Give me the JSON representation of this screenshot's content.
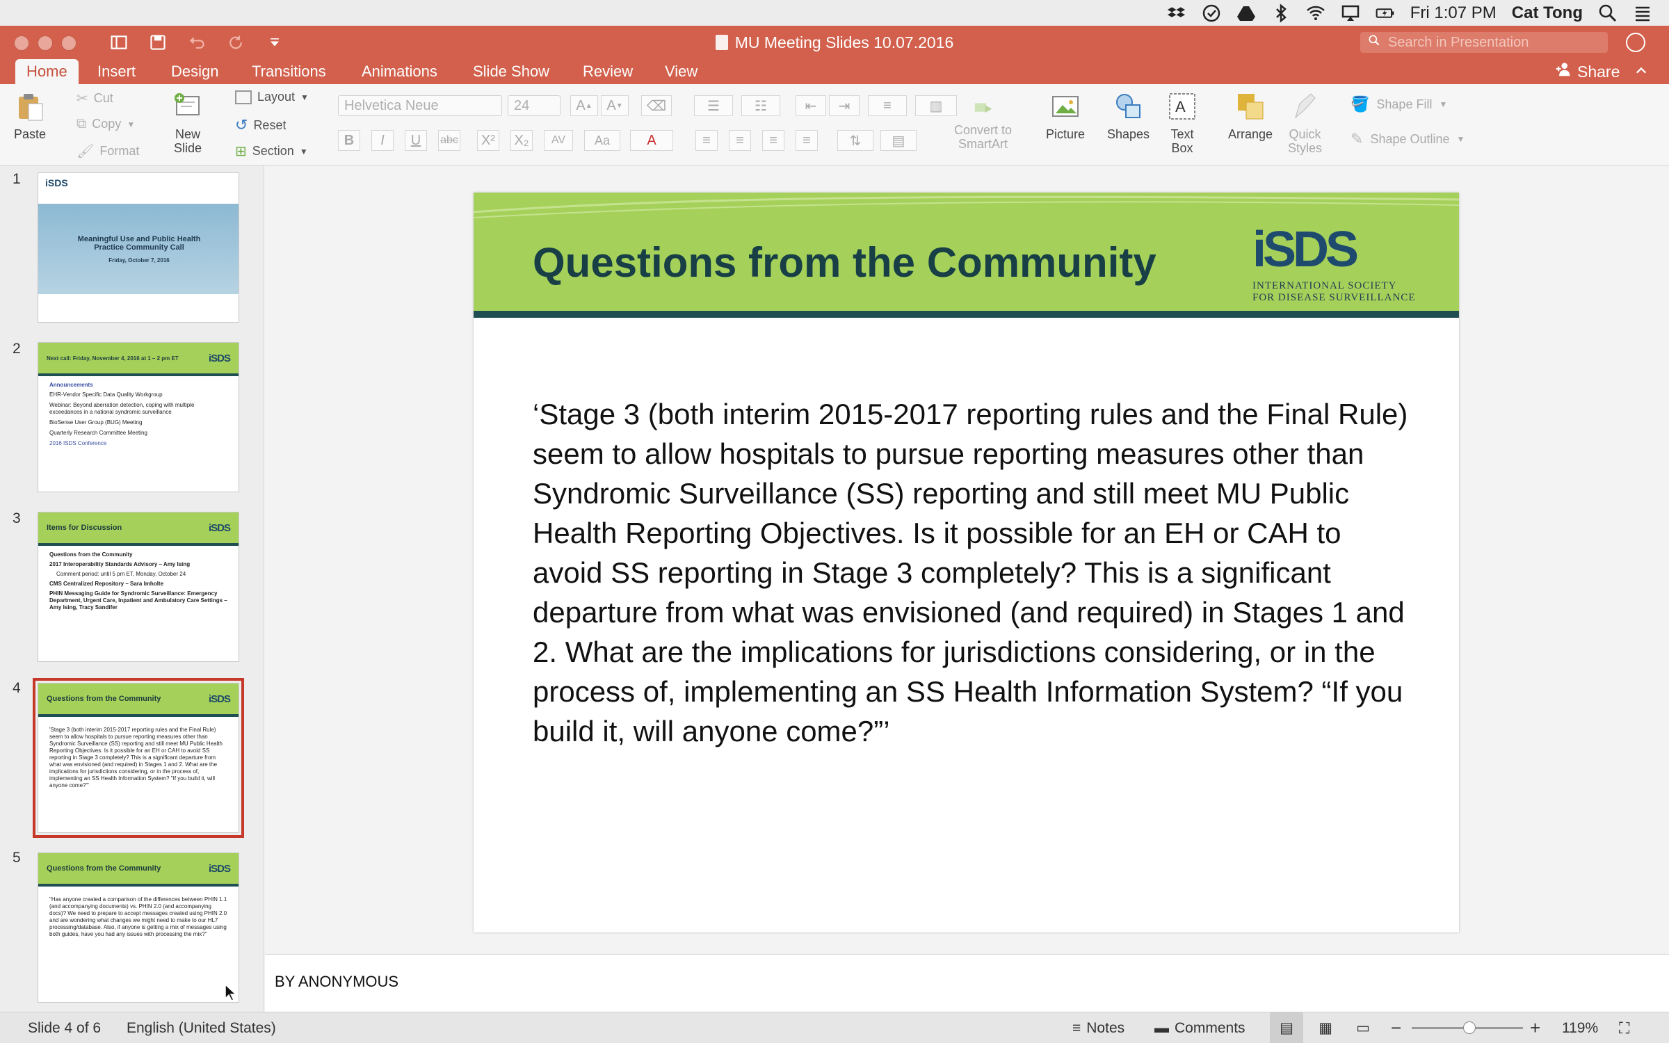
{
  "menubar": {
    "clock": "Fri 1:07 PM",
    "user": "Cat Tong"
  },
  "titlebar": {
    "document_title": "MU Meeting Slides 10.07.2016",
    "search_placeholder": "Search in Presentation"
  },
  "tabs": [
    {
      "label": "Home",
      "active": true
    },
    {
      "label": "Insert"
    },
    {
      "label": "Design"
    },
    {
      "label": "Transitions"
    },
    {
      "label": "Animations"
    },
    {
      "label": "Slide Show"
    },
    {
      "label": "Review"
    },
    {
      "label": "View"
    }
  ],
  "share_label": "Share",
  "ribbon": {
    "paste": "Paste",
    "cut": "Cut",
    "copy": "Copy",
    "format": "Format",
    "new_slide": [
      "New",
      "Slide"
    ],
    "layout": "Layout",
    "reset": "Reset",
    "section": "Section",
    "font_name": "Helvetica Neue",
    "font_size": "24",
    "convert_smartart": [
      "Convert to",
      "SmartArt"
    ],
    "picture": "Picture",
    "shapes": "Shapes",
    "text_box": [
      "Text",
      "Box"
    ],
    "arrange": "Arrange",
    "quick_styles": [
      "Quick",
      "Styles"
    ],
    "shape_fill": "Shape Fill",
    "shape_outline": "Shape Outline"
  },
  "thumbnails": [
    {
      "number": "1",
      "title": "Meaningful Use and Public Health Practice Community Call",
      "subtitle": "Friday, October 7, 2016"
    },
    {
      "number": "2",
      "title": "Next call: Friday, November 4, 2016 at 1 – 2 pm ET",
      "body_heading": "Announcements",
      "lines": [
        "EHR-Vendor Specific Data Quality Workgroup",
        "Webinar: Beyond aberration detection, coping with multiple exceedances in a national syndromic surveillance",
        "BioSense User Group (BUG) Meeting",
        "Quarterly Research Committee Meeting",
        "2016 ISDS Conference"
      ]
    },
    {
      "number": "3",
      "title": "Items for Discussion",
      "lines": [
        "Questions from the Community",
        "2017 Interoperability Standards Advisory – Amy Ising",
        "Comment period: until 5 pm ET, Monday, October 24",
        "CMS Centralized Repository – Sara Imholte",
        "PHIN Messaging Guide for Syndromic Surveillance: Emergency Department, Urgent Care, Inpatient and Ambulatory Care Settings – Amy Ising, Tracy Sandifer"
      ]
    },
    {
      "number": "4",
      "title": "Questions from the Community",
      "selected": true,
      "body": "'Stage 3 (both interim 2015-2017 reporting rules and the Final Rule) seem to allow hospitals to pursue reporting measures other than Syndromic Surveillance (SS) reporting and still meet MU Public Health Reporting Objectives. Is it possible for an EH or CAH to avoid SS reporting in Stage 3 completely? This is a significant departure from what was envisioned (and required) in Stages 1 and 2. What are the implications for jurisdictions considering, or in the process of, implementing an SS Health Information System? \"If you build it, will anyone come?\"'"
    },
    {
      "number": "5",
      "title": "Questions from the Community",
      "body": "\"Has anyone created a comparison of the differences between PHIN 1.1 (and accompanying documents) vs. PHIN 2.0 (and accompanying docs)? We need to prepare to accept messages created using PHIN 2.0 and are wondering what changes we might need to make to our HL7 processing/database. Also, if anyone is getting a mix of messages using both guides, have you had any issues with processing the mix?\""
    }
  ],
  "slide": {
    "title": "Questions from the Community",
    "logo_mark": "iSDS",
    "logo_line1": "INTERNATIONAL SOCIETY",
    "logo_line2": "FOR DISEASE SURVEILLANCE",
    "body": "‘Stage 3 (both interim 2015-2017 reporting rules and the Final Rule) seem to allow hospitals to pursue reporting measures other than Syndromic Surveillance (SS) reporting and still meet MU Public Health Reporting Objectives.  Is it possible for an EH or CAH to avoid SS reporting in Stage 3 completely?  This is a significant departure from what was envisioned (and required) in Stages 1 and 2.  What are the implications for jurisdictions considering, or in the process of, implementing an SS Health Information System?  “If you build it, will anyone come?”’"
  },
  "notes": "BY ANONYMOUS",
  "status": {
    "slide_counter": "Slide 4 of 6",
    "language": "English (United States)",
    "notes_button": "Notes",
    "comments_button": "Comments",
    "zoom": "119%"
  }
}
